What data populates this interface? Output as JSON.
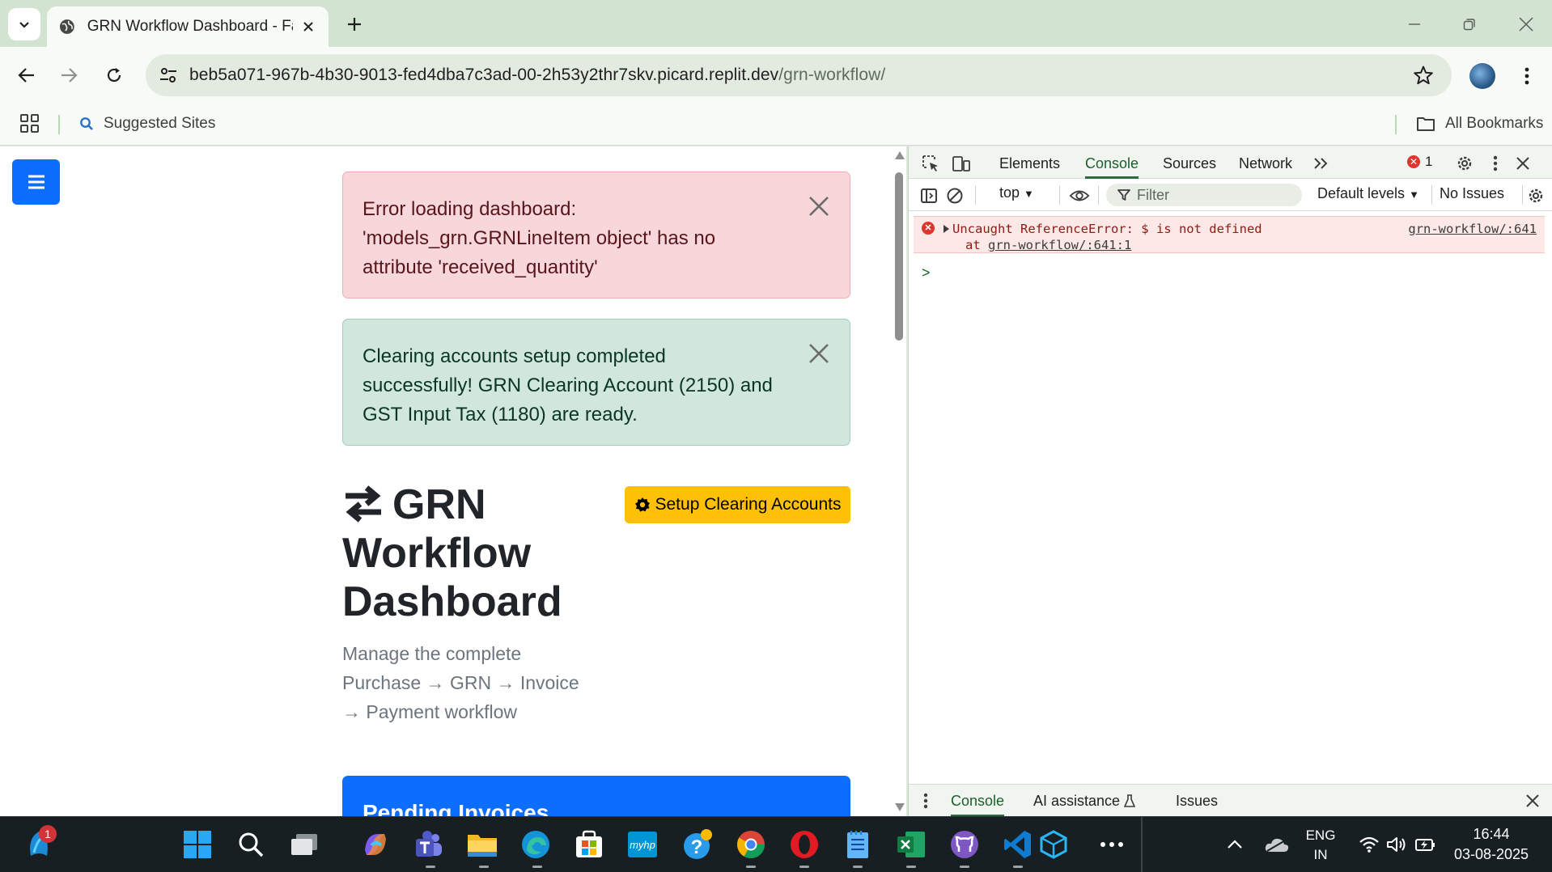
{
  "browser": {
    "tab_title": "GRN Workflow Dashboard - Fac",
    "url_host": "beb5a071-967b-4b30-9013-fed4dba7c3ad-00-2h53y2thr7skv.picard.replit.dev",
    "url_path": "/grn-workflow/",
    "bookmarks": {
      "suggested": "Suggested Sites",
      "all": "All Bookmarks"
    }
  },
  "page": {
    "error_alert": "Error loading dashboard: 'models_grn.GRNLineItem object' has no attribute 'received_quantity'",
    "success_alert": "Clearing accounts setup completed successfully! GRN Clearing Account (2150) and GST Input Tax (1180) are ready.",
    "title": "GRN Workflow Dashboard",
    "subtitle": "Manage the complete Purchase → GRN → Invoice → Payment workflow",
    "setup_button": "Setup Clearing Accounts",
    "card_header": "Pending Invoices"
  },
  "devtools": {
    "tabs": [
      "Elements",
      "Console",
      "Sources",
      "Network"
    ],
    "active_tab": "Console",
    "error_count": "1",
    "context": "top",
    "filter_placeholder": "Filter",
    "levels": "Default levels",
    "issues": "No Issues",
    "error_message": "Uncaught ReferenceError: $ is not defined",
    "error_at_prefix": "at ",
    "error_at_link": "grn-workflow/:641:1",
    "error_source": "grn-workflow/:641",
    "prompt": ">",
    "drawer_tabs": [
      "Console",
      "AI assistance",
      "Issues"
    ]
  },
  "taskbar": {
    "notification_badge": "1",
    "lang_top": "ENG",
    "lang_bottom": "IN",
    "time": "16:44",
    "date": "03-08-2025"
  },
  "colors": {
    "primary": "#0d6efd",
    "warning": "#ffc107",
    "danger_bg": "#f8d7da",
    "success_bg": "#d1e7dd",
    "chrome_green": "#d3e3d1"
  }
}
